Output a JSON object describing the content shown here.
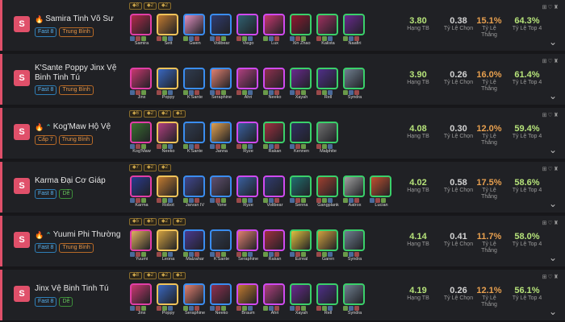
{
  "comps": [
    {
      "tier": "S",
      "name": "Samira Tinh Võ Sư",
      "fire": true,
      "chev": false,
      "tags": [
        {
          "t": "Fast 8",
          "c": "blue"
        },
        {
          "t": "Trung Bình",
          "c": "orange"
        }
      ],
      "augs": [
        "8",
        "2",
        "2"
      ],
      "champs": [
        [
          "Samira",
          "#e13ea6",
          "#b02a4a"
        ],
        [
          "Sett",
          "#f0c35a",
          "#c07a30"
        ],
        [
          "Gwen",
          "#3a8df0",
          "#e090c0"
        ],
        [
          "Volibear",
          "#3a8df0",
          "#303c70"
        ],
        [
          "Viego",
          "#d04af0",
          "#306070"
        ],
        [
          "Lux",
          "#d04af0",
          "#c83870"
        ],
        [
          "Xin Zhao",
          "#3ad06a",
          "#901a30"
        ],
        [
          "Kalista",
          "#3ad06a",
          "#a03060"
        ],
        [
          "Naafiri",
          "#3ad06a",
          "#6a2a90"
        ]
      ],
      "avg": "3.80",
      "pick": "0.38",
      "win": "15.1%",
      "top4": "64.3%"
    },
    {
      "tier": "S",
      "name": "K'Sante Poppy Jinx Vệ Binh Tinh Tú",
      "fire": false,
      "chev": false,
      "tags": [
        {
          "t": "Fast 8",
          "c": "blue"
        },
        {
          "t": "Trung Bình",
          "c": "orange"
        }
      ],
      "augs": [],
      "champs": [
        [
          "Jinx",
          "#e13ea6",
          "#c83870"
        ],
        [
          "Poppy",
          "#f0c35a",
          "#3a68c0"
        ],
        [
          "K'Sante",
          "#3a8df0",
          "#303c50"
        ],
        [
          "Seraphine",
          "#3a8df0",
          "#e08070"
        ],
        [
          "Ahri",
          "#d04af0",
          "#b04080"
        ],
        [
          "Neeko",
          "#d04af0",
          "#903050"
        ],
        [
          "Xayah",
          "#3ad06a",
          "#6a2a90"
        ],
        [
          "Rell",
          "#3ad06a",
          "#50308a"
        ],
        [
          "Syndra",
          "#3ad06a",
          "#708090"
        ]
      ],
      "avg": "3.90",
      "pick": "0.26",
      "win": "16.0%",
      "top4": "61.4%"
    },
    {
      "tier": "S",
      "name": "Kog'Maw Hộ Vệ",
      "fire": true,
      "chev": true,
      "tags": [
        {
          "t": "Cấp 7",
          "c": "orange"
        },
        {
          "t": "Trung Bình",
          "c": "orange"
        }
      ],
      "augs": [
        "6",
        "2",
        "2",
        "1"
      ],
      "champs": [
        [
          "Kog'Maw",
          "#e13ea6",
          "#3a7030"
        ],
        [
          "Neeko",
          "#f0c35a",
          "#b04080"
        ],
        [
          "K'Sante",
          "#3a8df0",
          "#303c50"
        ],
        [
          "Janna",
          "#3a8df0",
          "#e0a050"
        ],
        [
          "Ryze",
          "#d04af0",
          "#3a60a0"
        ],
        [
          "Rakan",
          "#3ad06a",
          "#a03040"
        ],
        [
          "Kennen",
          "#3ad06a",
          "#303060"
        ],
        [
          "Malphite",
          "#3ad06a",
          "#707070"
        ]
      ],
      "avg": "4.08",
      "pick": "0.30",
      "win": "12.0%",
      "top4": "59.4%"
    },
    {
      "tier": "S",
      "name": "Karma Đại Cơ Giáp",
      "fire": false,
      "chev": false,
      "tags": [
        {
          "t": "Fast 8",
          "c": "blue"
        },
        {
          "t": "Dễ",
          "c": "green"
        }
      ],
      "augs": [
        "7",
        "2",
        "2"
      ],
      "champs": [
        [
          "Karma",
          "#e13ea6",
          "#2a3a90"
        ],
        [
          "Robot",
          "#f0c35a",
          "#c07a30"
        ],
        [
          "Jarvan IV",
          "#3a8df0",
          "#404890"
        ],
        [
          "Yone",
          "#3a8df0",
          "#605070"
        ],
        [
          "Ryze",
          "#d04af0",
          "#3a60a0"
        ],
        [
          "Volibear",
          "#d04af0",
          "#303c70"
        ],
        [
          "Senna",
          "#3ad06a",
          "#207070"
        ],
        [
          "Gangplank",
          "#3ad06a",
          "#a04030"
        ],
        [
          "Aatrox",
          "#3ad06a",
          "#a0a0a0"
        ],
        [
          "Lucian",
          "#3ad06a",
          "#c05030"
        ]
      ],
      "avg": "4.02",
      "pick": "0.58",
      "win": "17.5%",
      "top4": "58.6%"
    },
    {
      "tier": "S",
      "name": "Yuumi Phi Thường",
      "fire": true,
      "chev": true,
      "tags": [
        {
          "t": "Fast 8",
          "c": "blue"
        },
        {
          "t": "Trung Bình",
          "c": "orange"
        }
      ],
      "augs": [
        "5",
        "5",
        "2",
        "2"
      ],
      "champs": [
        [
          "Yuumi",
          "#e13ea6",
          "#e0b060"
        ],
        [
          "Leona",
          "#f0c35a",
          "#d0a040"
        ],
        [
          "Malzahar",
          "#3a8df0",
          "#4a3a90"
        ],
        [
          "K'Sante",
          "#3a8df0",
          "#303c50"
        ],
        [
          "Seraphine",
          "#d04af0",
          "#e08070"
        ],
        [
          "Rakan",
          "#d04af0",
          "#a03040"
        ],
        [
          "Ezreal",
          "#3ad06a",
          "#e0c040"
        ],
        [
          "Garen",
          "#3ad06a",
          "#d0a040"
        ],
        [
          "Syndra",
          "#3ad06a",
          "#708090"
        ]
      ],
      "avg": "4.14",
      "pick": "0.41",
      "win": "11.7%",
      "top4": "58.0%"
    },
    {
      "tier": "S",
      "name": "Jinx Vệ Binh Tinh Tú",
      "fire": false,
      "chev": false,
      "tags": [
        {
          "t": "Fast 8",
          "c": "blue"
        },
        {
          "t": "Dễ",
          "c": "green"
        }
      ],
      "augs": [
        "8",
        "2",
        "2",
        "1"
      ],
      "champs": [
        [
          "Jinx",
          "#e13ea6",
          "#c83870"
        ],
        [
          "Poppy",
          "#f0c35a",
          "#3a68c0"
        ],
        [
          "Seraphine",
          "#3a8df0",
          "#e08070"
        ],
        [
          "Neeko",
          "#3a8df0",
          "#903050"
        ],
        [
          "Braum",
          "#d04af0",
          "#c07a30"
        ],
        [
          "Ahri",
          "#d04af0",
          "#b04080"
        ],
        [
          "Xayah",
          "#3ad06a",
          "#6a2a90"
        ],
        [
          "Rell",
          "#3ad06a",
          "#50308a"
        ],
        [
          "Syndra",
          "#3ad06a",
          "#708090"
        ]
      ],
      "avg": "4.19",
      "pick": "0.26",
      "win": "12.1%",
      "top4": "56.1%"
    }
  ],
  "labels": {
    "avg": "Hạng TB",
    "pick": "Tỷ Lệ Chọn",
    "win": "Tỷ Lệ Thắng",
    "top4": "Tỷ Lệ Top 4"
  }
}
